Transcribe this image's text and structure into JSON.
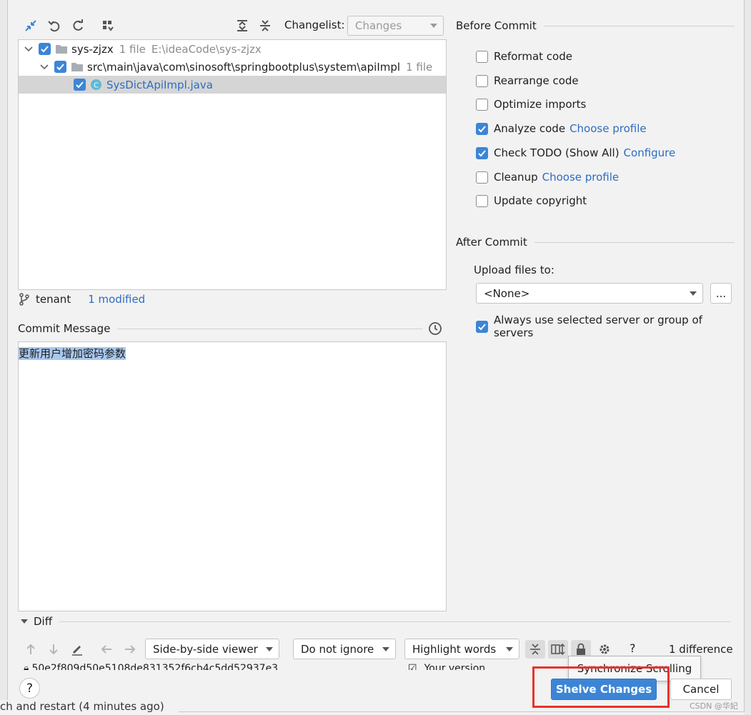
{
  "toolbar": {
    "changelist_label": "Changelist:",
    "changelist_value": "Changes"
  },
  "tree": {
    "root": {
      "name": "sys-zjzx",
      "count": "1 file",
      "path": "E:\\ideaCode\\sys-zjzx"
    },
    "folder": {
      "name": "src\\main\\java\\com\\sinosoft\\springbootplus\\system\\apiImpl",
      "count": "1 file"
    },
    "file": {
      "name": "SysDictApiImpl.java"
    }
  },
  "status": {
    "branch": "tenant",
    "modified": "1 modified"
  },
  "commit_message": {
    "label": "Commit Message",
    "text": "更新用户增加密码参数"
  },
  "before_commit": {
    "title": "Before Commit",
    "items": [
      {
        "label": "Reformat code",
        "checked": false,
        "link": ""
      },
      {
        "label": "Rearrange code",
        "checked": false,
        "link": ""
      },
      {
        "label": "Optimize imports",
        "checked": false,
        "link": ""
      },
      {
        "label": "Analyze code",
        "checked": true,
        "link": "Choose profile"
      },
      {
        "label": "Check TODO (Show All)",
        "checked": true,
        "link": "Configure"
      },
      {
        "label": "Cleanup",
        "checked": false,
        "link": "Choose profile"
      },
      {
        "label": "Update copyright",
        "checked": false,
        "link": ""
      }
    ]
  },
  "after_commit": {
    "title": "After Commit",
    "upload_label": "Upload files to:",
    "upload_value": "<None>",
    "more_label": "...",
    "always_use_label": "Always use selected server or group of servers"
  },
  "diff": {
    "title": "Diff",
    "viewer": "Side-by-side viewer",
    "ignore": "Do not ignore",
    "highlight": "Highlight words",
    "help": "?",
    "differences": "1 difference",
    "hash": "50e2f809d50e5108de831352f6cb4c5dd52937e3",
    "your_version": "Your version"
  },
  "tooltip": "Synchronize Scrolling",
  "buttons": {
    "shelve": "Shelve Changes",
    "cancel": "Cancel",
    "help": "?"
  },
  "background": {
    "bottom_text": "ch and restart (4 minutes ago)",
    "watermark": "CSDN @华妃"
  },
  "colors": {
    "accent": "#3c85d6",
    "link": "#2f6cc0",
    "highlight_box": "#e8332b"
  }
}
